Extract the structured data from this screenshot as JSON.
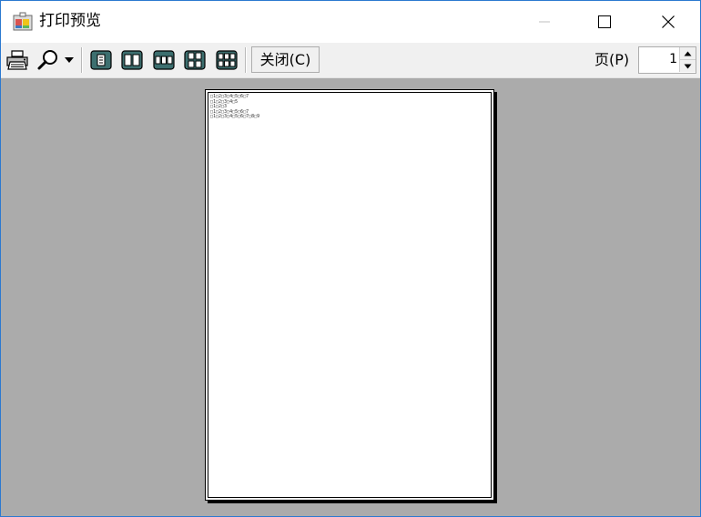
{
  "window": {
    "title": "打印预览"
  },
  "toolbar": {
    "close_label": "关闭(C)",
    "page_label": "页(P)",
    "page_value": "1",
    "icons": {
      "print": "printer-icon",
      "zoom": "magnifier-icon",
      "one_page": "one-page-icon",
      "two_pages": "two-pages-icon",
      "three_pages": "three-pages-icon",
      "four_pages": "four-pages-icon",
      "six_pages": "six-pages-icon"
    }
  },
  "preview": {
    "lines": [
      "□1□2□3□4□5□6□7",
      "□1□2□3□4□5",
      "□1□2□3",
      "□1□2□3□4□5□6□7",
      "□1□2□3□4□5□6□7□8□9"
    ]
  },
  "colors": {
    "preview_bg": "#ababab",
    "toolbar_bg": "#f0f0f0",
    "window_border": "#2b79d0"
  }
}
